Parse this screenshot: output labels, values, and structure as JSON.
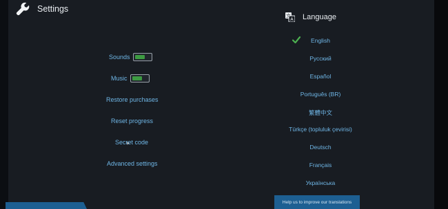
{
  "header": {
    "title": "Settings",
    "icon": "wrench-icon"
  },
  "menu": {
    "sounds_label": "Sounds",
    "sounds_on": true,
    "music_label": "Music",
    "music_on": true,
    "restore_label": "Restore purchases",
    "reset_label": "Reset progress",
    "secret_label": "Secret code",
    "advanced_label": "Advanced settings"
  },
  "language": {
    "title": "Language",
    "icon": "translate-icon",
    "selected": "English",
    "items": [
      "English",
      "Русский",
      "Español",
      "Português (BR)",
      "繁體中文",
      "Türkçe (topluluk çevirisi)",
      "Deutsch",
      "Français",
      "Українська"
    ],
    "help_label": "Help us to improve our translations"
  },
  "colors": {
    "accent": "#6fb6e6",
    "toggle_on": "#3d9a42",
    "button": "#1d5f92",
    "panel": "#181c22"
  }
}
